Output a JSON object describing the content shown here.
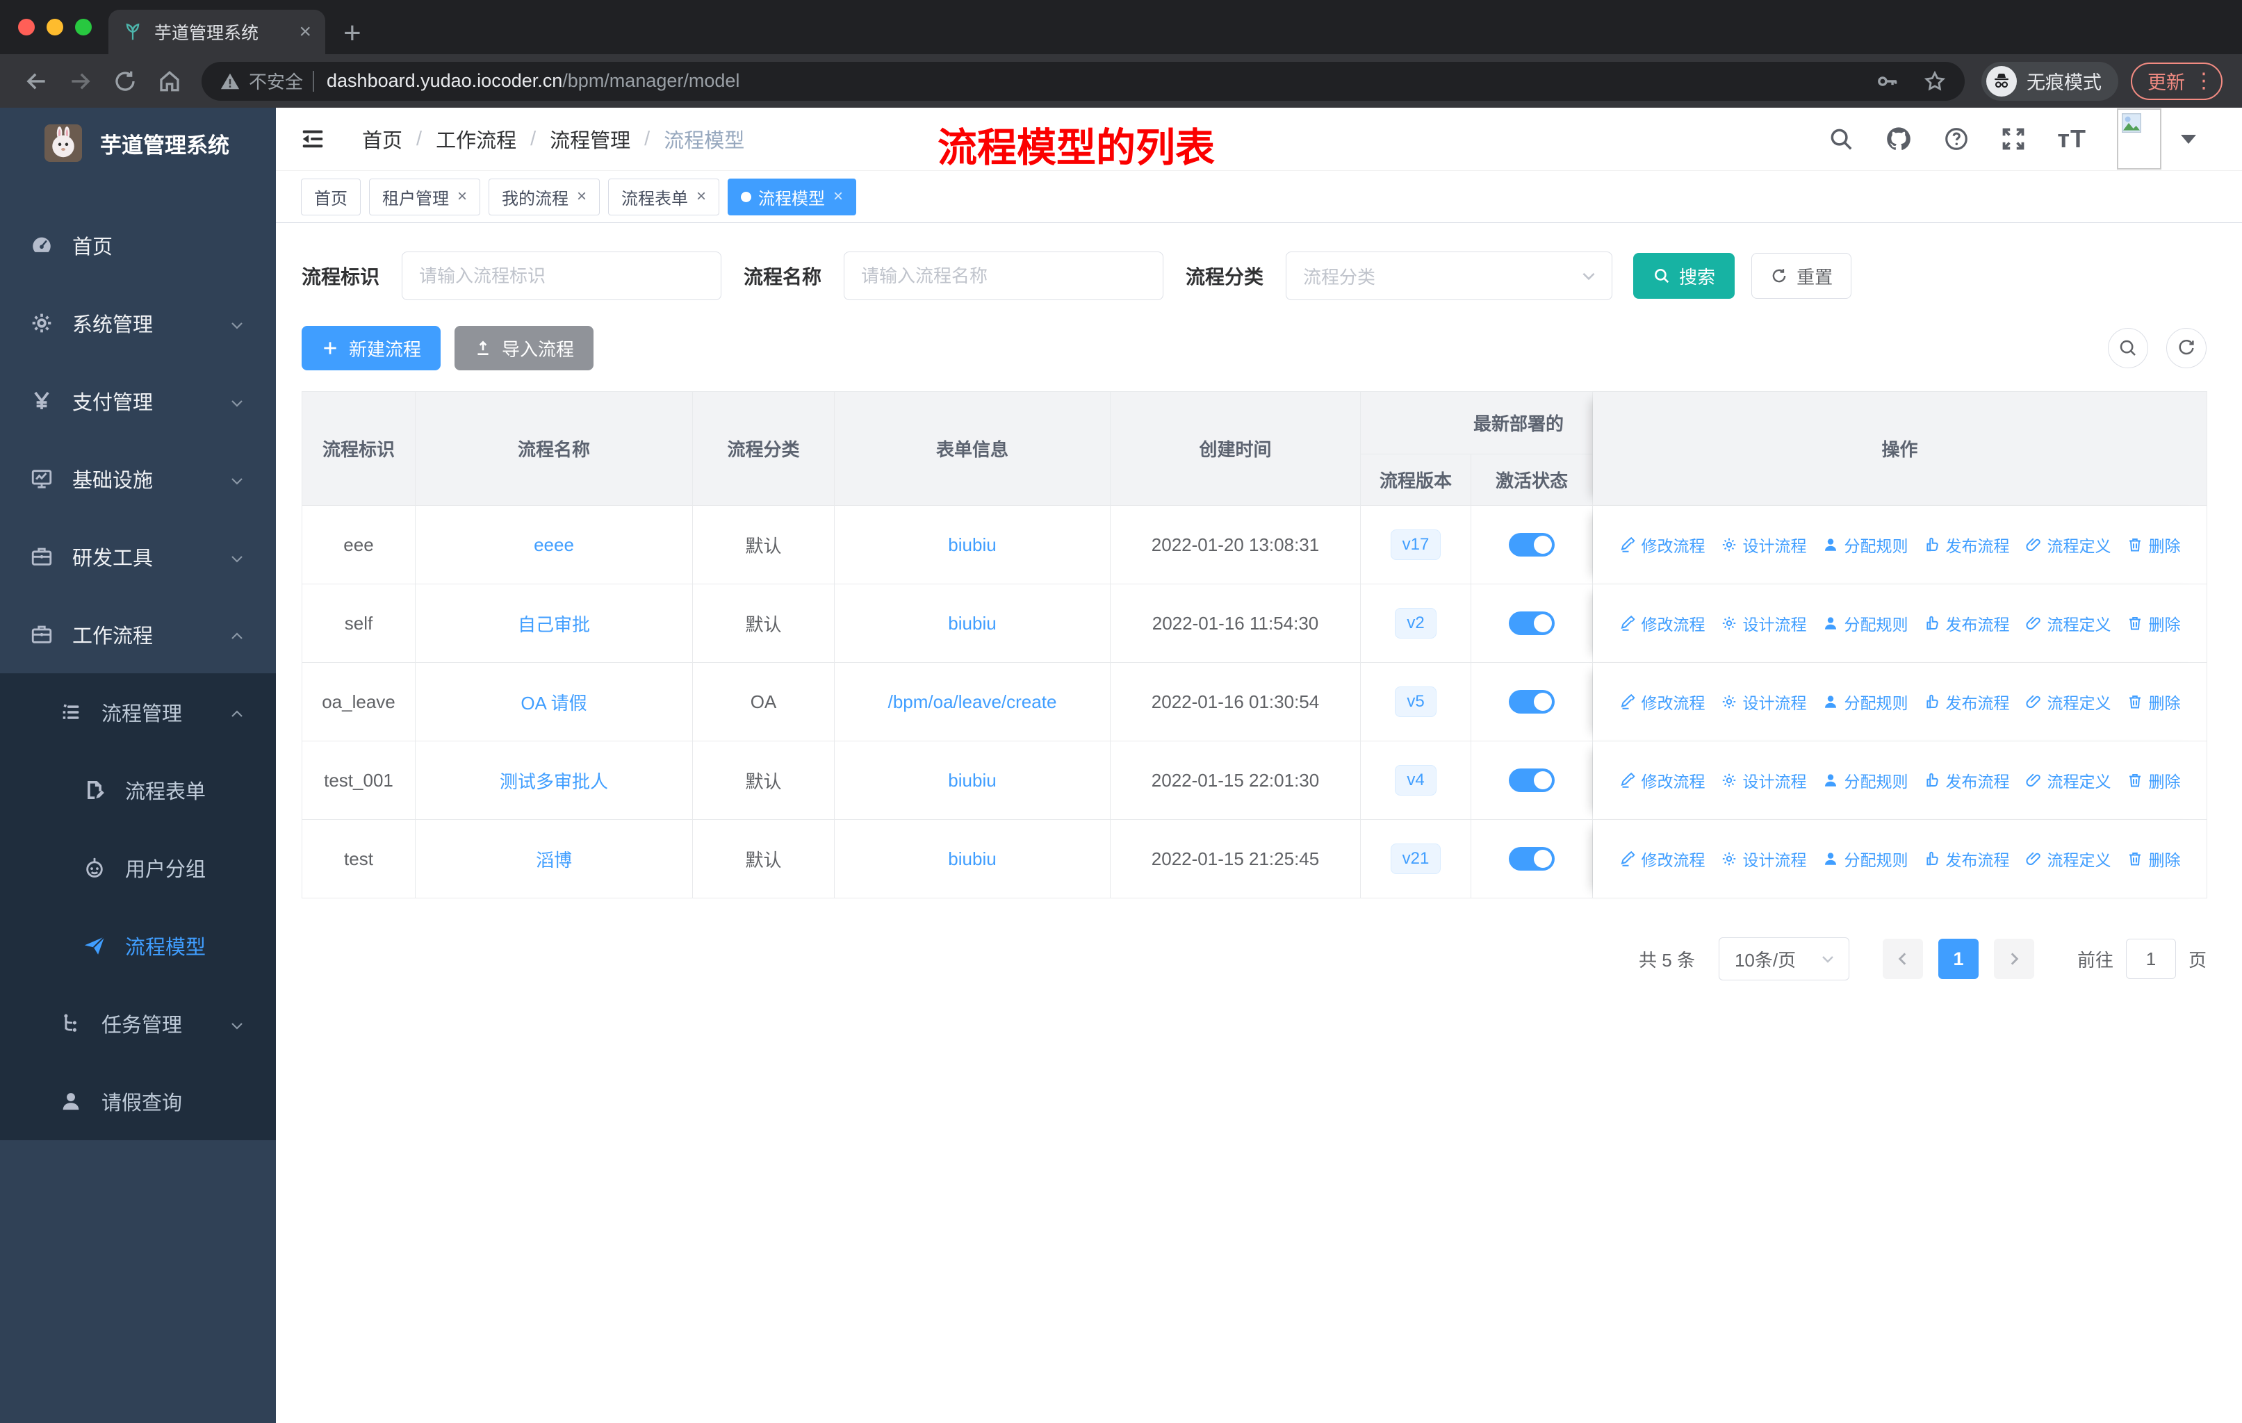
{
  "browser": {
    "tab_title": "芋道管理系统",
    "security_label": "不安全",
    "url_domain": "dashboard.yudao.iocoder.cn",
    "url_path": "/bpm/manager/model",
    "incognito_label": "无痕模式",
    "update_label": "更新"
  },
  "sidebar": {
    "logo_title": "芋道管理系统",
    "items": [
      {
        "label": "首页",
        "icon": "dashboard",
        "level": 0
      },
      {
        "label": "系统管理",
        "icon": "gear",
        "level": 0,
        "chevron": "down"
      },
      {
        "label": "支付管理",
        "icon": "yen",
        "level": 0,
        "chevron": "down"
      },
      {
        "label": "基础设施",
        "icon": "monitor",
        "level": 0,
        "chevron": "down"
      },
      {
        "label": "研发工具",
        "icon": "briefcase",
        "level": 0,
        "chevron": "down"
      },
      {
        "label": "工作流程",
        "icon": "briefcase",
        "level": 0,
        "chevron": "up"
      },
      {
        "label": "流程管理",
        "icon": "list",
        "level": 1,
        "chevron": "up",
        "sub": true
      },
      {
        "label": "流程表单",
        "icon": "form",
        "level": 2,
        "sub": true
      },
      {
        "label": "用户分组",
        "icon": "robot",
        "level": 2,
        "sub": true
      },
      {
        "label": "流程模型",
        "icon": "plane",
        "level": 2,
        "sub": true,
        "active": true
      },
      {
        "label": "任务管理",
        "icon": "tasks",
        "level": 1,
        "chevron": "down",
        "sub": true
      },
      {
        "label": "请假查询",
        "icon": "user",
        "level": 1,
        "sub": true
      }
    ]
  },
  "navbar": {
    "breadcrumb": [
      "首页",
      "工作流程",
      "流程管理",
      "流程模型"
    ],
    "annotation": "流程模型的列表"
  },
  "tags": [
    {
      "label": "首页",
      "closable": false,
      "active": false
    },
    {
      "label": "租户管理",
      "closable": true,
      "active": false
    },
    {
      "label": "我的流程",
      "closable": true,
      "active": false
    },
    {
      "label": "流程表单",
      "closable": true,
      "active": false
    },
    {
      "label": "流程模型",
      "closable": true,
      "active": true
    }
  ],
  "filters": {
    "key_label": "流程标识",
    "key_placeholder": "请输入流程标识",
    "name_label": "流程名称",
    "name_placeholder": "请输入流程名称",
    "category_label": "流程分类",
    "category_placeholder": "流程分类",
    "search_label": "搜索",
    "reset_label": "重置"
  },
  "actions_bar": {
    "create_label": "新建流程",
    "import_label": "导入流程"
  },
  "table": {
    "headers": {
      "key": "流程标识",
      "name": "流程名称",
      "category": "流程分类",
      "form": "表单信息",
      "created": "创建时间",
      "deploy_group": "最新部署的",
      "version": "流程版本",
      "active": "激活状态",
      "ops": "操作"
    },
    "row_actions": [
      "修改流程",
      "设计流程",
      "分配规则",
      "发布流程",
      "流程定义",
      "删除"
    ],
    "rows": [
      {
        "key": "eee",
        "name": "eeee",
        "category": "默认",
        "form": "biubiu",
        "created": "2022-01-20 13:08:31",
        "version": "v17",
        "active": true
      },
      {
        "key": "self",
        "name": "自己审批",
        "category": "默认",
        "form": "biubiu",
        "created": "2022-01-16 11:54:30",
        "version": "v2",
        "active": true
      },
      {
        "key": "oa_leave",
        "name": "OA 请假",
        "category": "OA",
        "form": "/bpm/oa/leave/create",
        "created": "2022-01-16 01:30:54",
        "version": "v5",
        "active": true
      },
      {
        "key": "test_001",
        "name": "测试多审批人",
        "category": "默认",
        "form": "biubiu",
        "created": "2022-01-15 22:01:30",
        "version": "v4",
        "active": true
      },
      {
        "key": "test",
        "name": "滔博",
        "category": "默认",
        "form": "biubiu",
        "created": "2022-01-15 21:25:45",
        "version": "v21",
        "active": true
      }
    ]
  },
  "pagination": {
    "total": "共 5 条",
    "page_size": "10条/页",
    "current": "1",
    "goto_label": "前往",
    "goto_value": "1",
    "unit_label": "页"
  },
  "colors": {
    "primary": "#409eff",
    "sidebar_bg": "#304156",
    "submenu_bg": "#1f2d3d",
    "search_teal": "#17b3a3",
    "info_gray": "#909399",
    "annotation_red": "#fb0000"
  }
}
